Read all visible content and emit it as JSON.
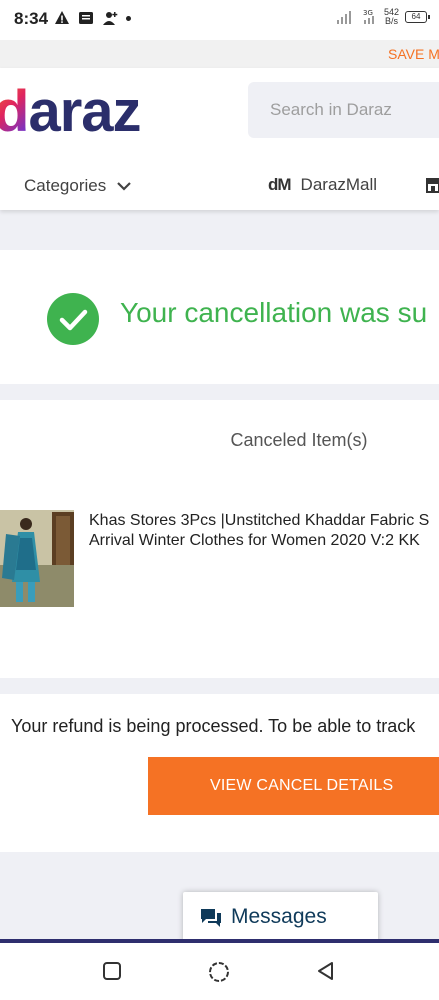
{
  "status_bar": {
    "time": "8:34",
    "net_speed_value": "542",
    "net_speed_unit": "B/s",
    "battery": "64"
  },
  "promo": {
    "text": "SAVE M"
  },
  "header": {
    "logo": {
      "first": "d",
      "rest": "araz"
    },
    "search_placeholder": "Search in Daraz",
    "categories_label": "Categories",
    "darazmall_label": "DarazMall",
    "darazmall_icon_text": "dM"
  },
  "success": {
    "message": "Your cancellation was su"
  },
  "canceled": {
    "title": "Canceled Item(s)",
    "items": [
      {
        "name_line1": "Khas Stores 3Pcs |Unstitched Khaddar Fabric S",
        "name_line2": "Arrival Winter Clothes for Women 2020 V:2 KK"
      }
    ]
  },
  "refund": {
    "message": "Your refund is being processed. To be able to track",
    "button_label": "VIEW CANCEL DETAILS"
  },
  "messages": {
    "label": "Messages"
  },
  "colors": {
    "brand_orange": "#f57224",
    "success_green": "#3fb34f",
    "logo_navy": "#2b2e6b"
  }
}
